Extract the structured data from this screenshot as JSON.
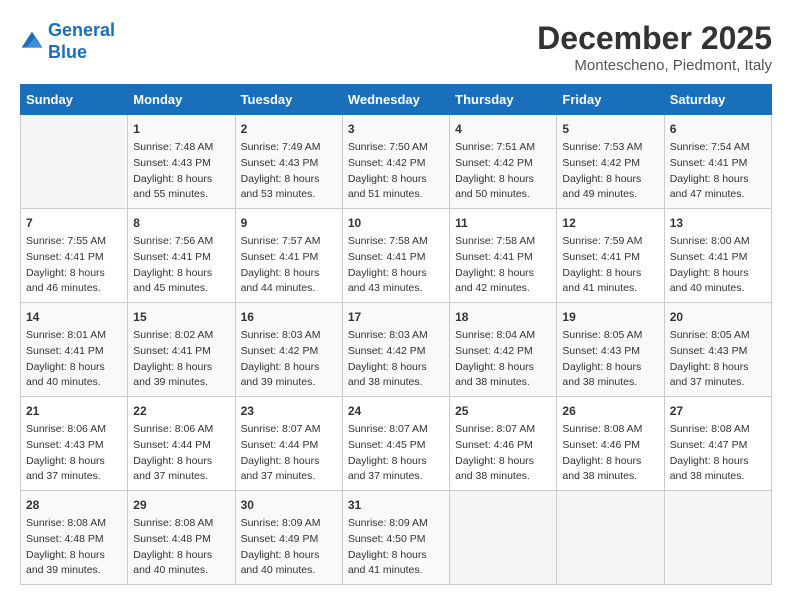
{
  "header": {
    "logo_line1": "General",
    "logo_line2": "Blue",
    "month_title": "December 2025",
    "subtitle": "Montescheno, Piedmont, Italy"
  },
  "weekdays": [
    "Sunday",
    "Monday",
    "Tuesday",
    "Wednesday",
    "Thursday",
    "Friday",
    "Saturday"
  ],
  "weeks": [
    [
      {
        "day": "",
        "content": ""
      },
      {
        "day": "1",
        "content": "Sunrise: 7:48 AM\nSunset: 4:43 PM\nDaylight: 8 hours\nand 55 minutes."
      },
      {
        "day": "2",
        "content": "Sunrise: 7:49 AM\nSunset: 4:43 PM\nDaylight: 8 hours\nand 53 minutes."
      },
      {
        "day": "3",
        "content": "Sunrise: 7:50 AM\nSunset: 4:42 PM\nDaylight: 8 hours\nand 51 minutes."
      },
      {
        "day": "4",
        "content": "Sunrise: 7:51 AM\nSunset: 4:42 PM\nDaylight: 8 hours\nand 50 minutes."
      },
      {
        "day": "5",
        "content": "Sunrise: 7:53 AM\nSunset: 4:42 PM\nDaylight: 8 hours\nand 49 minutes."
      },
      {
        "day": "6",
        "content": "Sunrise: 7:54 AM\nSunset: 4:41 PM\nDaylight: 8 hours\nand 47 minutes."
      }
    ],
    [
      {
        "day": "7",
        "content": "Sunrise: 7:55 AM\nSunset: 4:41 PM\nDaylight: 8 hours\nand 46 minutes."
      },
      {
        "day": "8",
        "content": "Sunrise: 7:56 AM\nSunset: 4:41 PM\nDaylight: 8 hours\nand 45 minutes."
      },
      {
        "day": "9",
        "content": "Sunrise: 7:57 AM\nSunset: 4:41 PM\nDaylight: 8 hours\nand 44 minutes."
      },
      {
        "day": "10",
        "content": "Sunrise: 7:58 AM\nSunset: 4:41 PM\nDaylight: 8 hours\nand 43 minutes."
      },
      {
        "day": "11",
        "content": "Sunrise: 7:58 AM\nSunset: 4:41 PM\nDaylight: 8 hours\nand 42 minutes."
      },
      {
        "day": "12",
        "content": "Sunrise: 7:59 AM\nSunset: 4:41 PM\nDaylight: 8 hours\nand 41 minutes."
      },
      {
        "day": "13",
        "content": "Sunrise: 8:00 AM\nSunset: 4:41 PM\nDaylight: 8 hours\nand 40 minutes."
      }
    ],
    [
      {
        "day": "14",
        "content": "Sunrise: 8:01 AM\nSunset: 4:41 PM\nDaylight: 8 hours\nand 40 minutes."
      },
      {
        "day": "15",
        "content": "Sunrise: 8:02 AM\nSunset: 4:41 PM\nDaylight: 8 hours\nand 39 minutes."
      },
      {
        "day": "16",
        "content": "Sunrise: 8:03 AM\nSunset: 4:42 PM\nDaylight: 8 hours\nand 39 minutes."
      },
      {
        "day": "17",
        "content": "Sunrise: 8:03 AM\nSunset: 4:42 PM\nDaylight: 8 hours\nand 38 minutes."
      },
      {
        "day": "18",
        "content": "Sunrise: 8:04 AM\nSunset: 4:42 PM\nDaylight: 8 hours\nand 38 minutes."
      },
      {
        "day": "19",
        "content": "Sunrise: 8:05 AM\nSunset: 4:43 PM\nDaylight: 8 hours\nand 38 minutes."
      },
      {
        "day": "20",
        "content": "Sunrise: 8:05 AM\nSunset: 4:43 PM\nDaylight: 8 hours\nand 37 minutes."
      }
    ],
    [
      {
        "day": "21",
        "content": "Sunrise: 8:06 AM\nSunset: 4:43 PM\nDaylight: 8 hours\nand 37 minutes."
      },
      {
        "day": "22",
        "content": "Sunrise: 8:06 AM\nSunset: 4:44 PM\nDaylight: 8 hours\nand 37 minutes."
      },
      {
        "day": "23",
        "content": "Sunrise: 8:07 AM\nSunset: 4:44 PM\nDaylight: 8 hours\nand 37 minutes."
      },
      {
        "day": "24",
        "content": "Sunrise: 8:07 AM\nSunset: 4:45 PM\nDaylight: 8 hours\nand 37 minutes."
      },
      {
        "day": "25",
        "content": "Sunrise: 8:07 AM\nSunset: 4:46 PM\nDaylight: 8 hours\nand 38 minutes."
      },
      {
        "day": "26",
        "content": "Sunrise: 8:08 AM\nSunset: 4:46 PM\nDaylight: 8 hours\nand 38 minutes."
      },
      {
        "day": "27",
        "content": "Sunrise: 8:08 AM\nSunset: 4:47 PM\nDaylight: 8 hours\nand 38 minutes."
      }
    ],
    [
      {
        "day": "28",
        "content": "Sunrise: 8:08 AM\nSunset: 4:48 PM\nDaylight: 8 hours\nand 39 minutes."
      },
      {
        "day": "29",
        "content": "Sunrise: 8:08 AM\nSunset: 4:48 PM\nDaylight: 8 hours\nand 40 minutes."
      },
      {
        "day": "30",
        "content": "Sunrise: 8:09 AM\nSunset: 4:49 PM\nDaylight: 8 hours\nand 40 minutes."
      },
      {
        "day": "31",
        "content": "Sunrise: 8:09 AM\nSunset: 4:50 PM\nDaylight: 8 hours\nand 41 minutes."
      },
      {
        "day": "",
        "content": ""
      },
      {
        "day": "",
        "content": ""
      },
      {
        "day": "",
        "content": ""
      }
    ]
  ]
}
